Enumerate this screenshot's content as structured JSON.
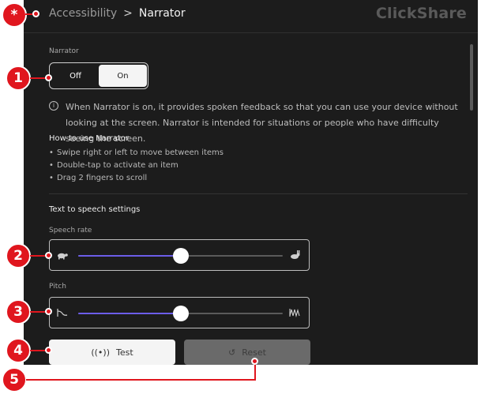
{
  "breadcrumb": {
    "parent": "Accessibility",
    "separator": ">",
    "current": "Narrator"
  },
  "brand": "ClickShare",
  "narrator": {
    "label": "Narrator",
    "toggle_off": "Off",
    "toggle_on": "On",
    "selected": "On",
    "info": "When Narrator is on, it provides spoken feedback so that you can use your device without looking at the screen. Narrator is intended for situations or people who have difficulty seeing the screen."
  },
  "howto": {
    "title": "How to use Narrator",
    "items": [
      "Swipe right or left to move between items",
      "Double-tap to activate an item",
      "Drag 2 fingers to scroll"
    ]
  },
  "tts": {
    "title": "Text to speech settings",
    "speech_rate": {
      "label": "Speech rate",
      "value_fraction": 0.5,
      "left_icon": "turtle-icon",
      "right_icon": "rabbit-icon"
    },
    "pitch": {
      "label": "Pitch",
      "value_fraction": 0.5,
      "left_icon": "low-pitch-icon",
      "right_icon": "high-pitch-icon"
    }
  },
  "buttons": {
    "test_label": "Test",
    "test_icon": "broadcast-icon",
    "reset_label": "Reset",
    "reset_icon": "undo-icon"
  },
  "annotations": [
    "*",
    "1",
    "2",
    "3",
    "4",
    "5"
  ],
  "colors": {
    "background": "#1c1c1c",
    "accent": "#6b5de8",
    "marker": "#e0161e"
  }
}
